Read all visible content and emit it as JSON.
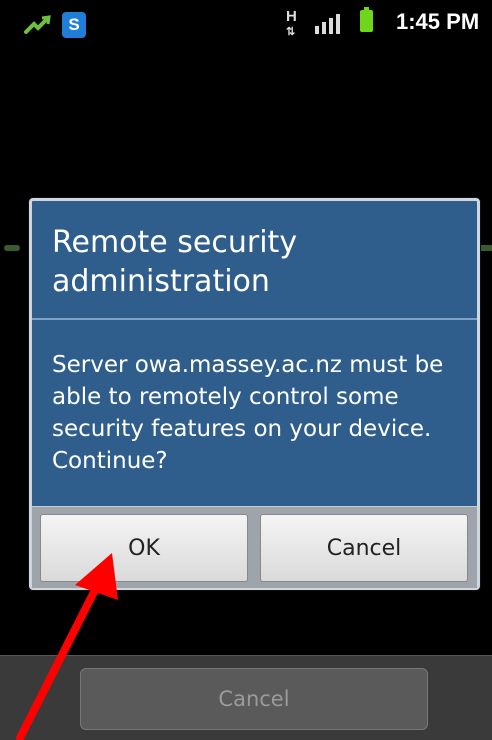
{
  "status_bar": {
    "icons": [
      "usb-debug-icon",
      "skype-icon",
      "hspa-network-icon",
      "signal-strength-icon",
      "battery-icon"
    ],
    "skype_glyph": "S",
    "network_glyph": "H",
    "time": "1:45 PM",
    "battery_color": "#6fd61c"
  },
  "dialog": {
    "title": "Remote security administration",
    "message": "Server owa.massey.ac.nz must be able to remotely control some security features on your device. Continue?",
    "ok_label": "OK",
    "cancel_label": "Cancel",
    "background_color": "#2f5e8c"
  },
  "background": {
    "cancel_label": "Cancel"
  },
  "annotation": {
    "arrow_color": "#ff0000",
    "points_to": "ok-button"
  }
}
